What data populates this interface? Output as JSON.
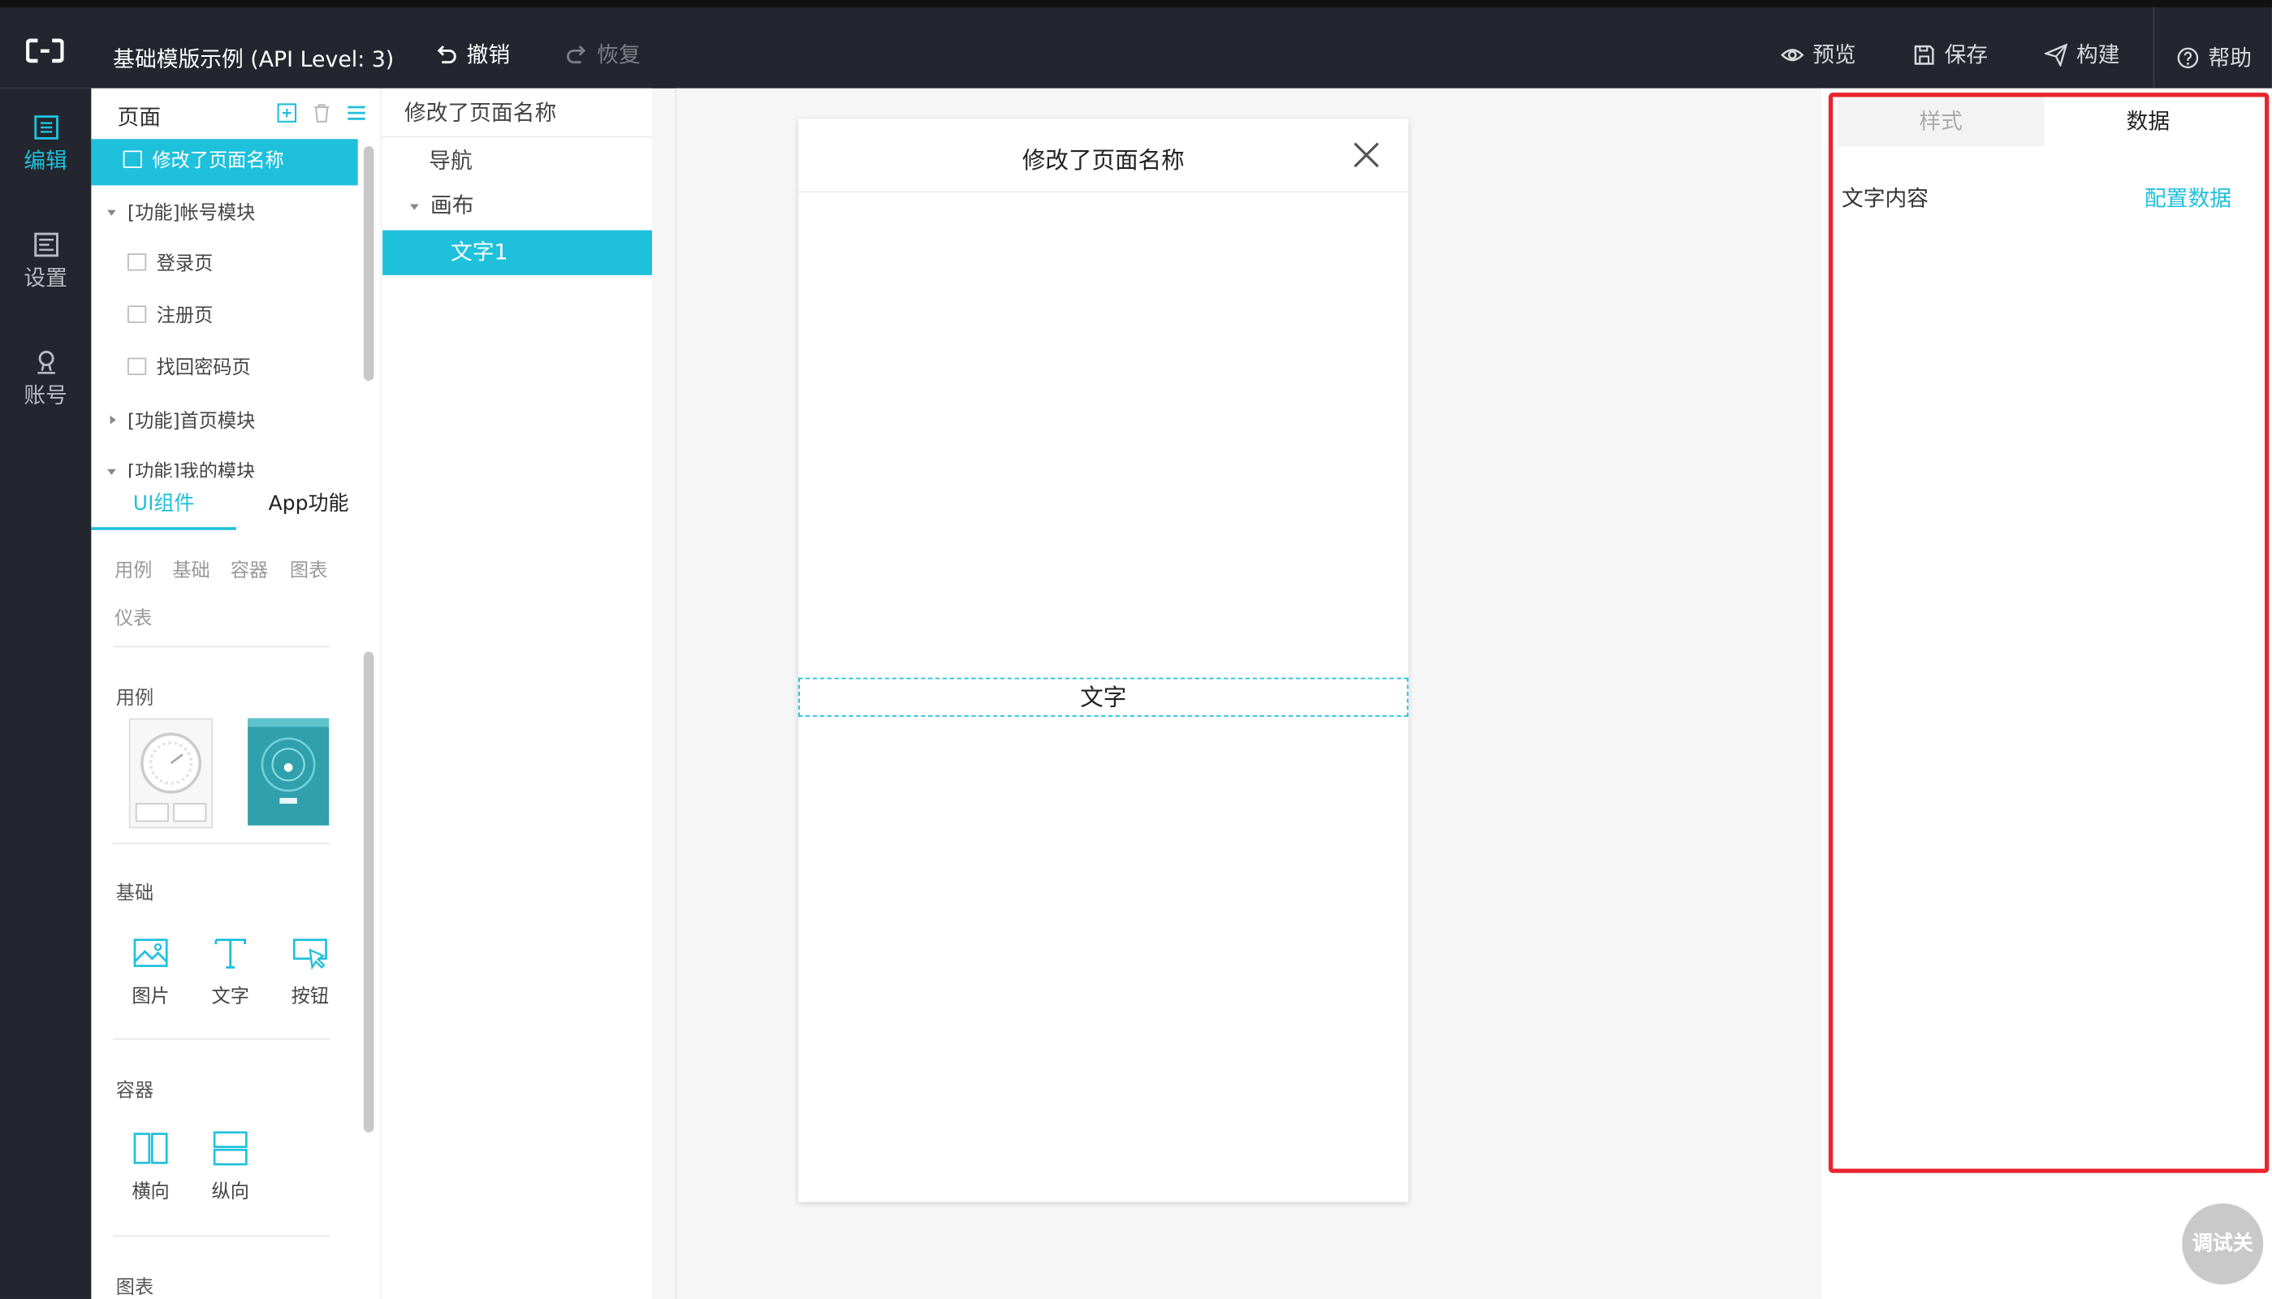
{
  "header": {
    "title": "基础模版示例 (API Level: 3)",
    "undo": "撤销",
    "redo": "恢复",
    "preview": "预览",
    "save": "保存",
    "build": "构建",
    "help": "帮助"
  },
  "leftnav": {
    "items": [
      {
        "label": "编辑",
        "icon": "edit-icon"
      },
      {
        "label": "设置",
        "icon": "settings-list-icon"
      },
      {
        "label": "账号",
        "icon": "user-icon"
      }
    ]
  },
  "pages": {
    "title": "页面",
    "items": [
      {
        "label": "修改了页面名称",
        "type": "page"
      },
      {
        "label": "[功能]帐号模块",
        "type": "group-open"
      },
      {
        "label": "登录页",
        "type": "page"
      },
      {
        "label": "注册页",
        "type": "page"
      },
      {
        "label": "找回密码页",
        "type": "page"
      },
      {
        "label": "[功能]首页模块",
        "type": "group-closed"
      },
      {
        "label": "[功能]我的模块",
        "type": "group-open"
      }
    ]
  },
  "components": {
    "tabs": [
      "UI组件",
      "App功能"
    ],
    "categories": [
      "用例",
      "基础",
      "容器",
      "图表",
      "仪表"
    ],
    "sections": {
      "examples": "用例",
      "basic": "基础",
      "container": "容器",
      "chart": "图表"
    },
    "basic_items": [
      "图片",
      "文字",
      "按钮"
    ],
    "container_items": [
      "横向",
      "纵向"
    ]
  },
  "tree": {
    "root": "修改了页面名称",
    "items": [
      "导航",
      "画布",
      "文字1"
    ]
  },
  "canvas": {
    "page_title": "修改了页面名称",
    "text_element": "文字"
  },
  "props": {
    "tabs": [
      "样式",
      "数据"
    ],
    "field_label": "文字内容",
    "config_link": "配置数据"
  },
  "debug_button": "调试关",
  "colors": {
    "accent": "#1fc0dc",
    "header_bg": "#23262e",
    "highlight_border": "#e8242e"
  }
}
